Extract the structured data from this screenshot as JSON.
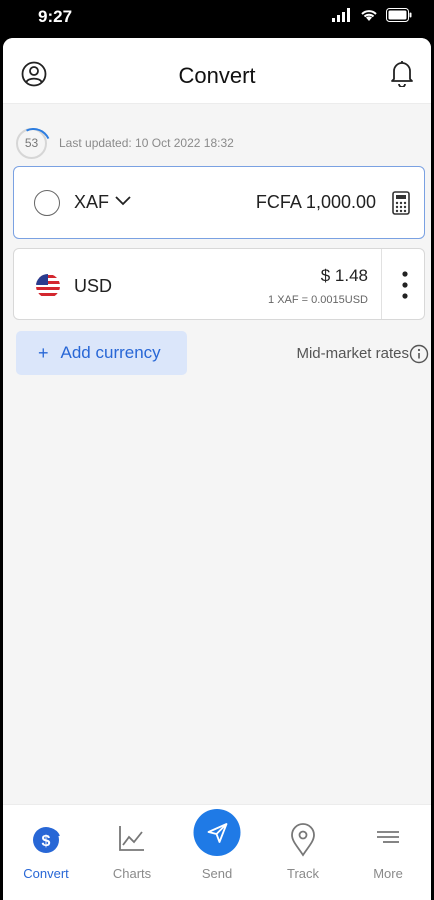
{
  "status_bar": {
    "time": "9:27"
  },
  "header": {
    "title": "Convert"
  },
  "update": {
    "countdown": "53",
    "last_updated": "Last updated: 10 Oct 2022 18:32"
  },
  "base_currency": {
    "code": "XAF",
    "amount": "FCFA 1,000.00"
  },
  "target_currency": {
    "code": "USD",
    "amount": "$ 1.48",
    "rate": "1 XAF = 0.0015USD"
  },
  "actions": {
    "add_currency": "Add currency",
    "mid_market": "Mid-market rates"
  },
  "tabs": [
    {
      "label": "Convert",
      "icon": "dollar-icon",
      "active": true
    },
    {
      "label": "Charts",
      "icon": "chart-icon",
      "active": false
    },
    {
      "label": "Send",
      "icon": "send-icon",
      "active": false
    },
    {
      "label": "Track",
      "icon": "location-pin-icon",
      "active": false
    },
    {
      "label": "More",
      "icon": "menu-icon",
      "active": false
    }
  ],
  "colors": {
    "accent": "#2867d6",
    "send_bubble": "#1f7ae6",
    "add_button_bg": "#dbe6fa"
  }
}
